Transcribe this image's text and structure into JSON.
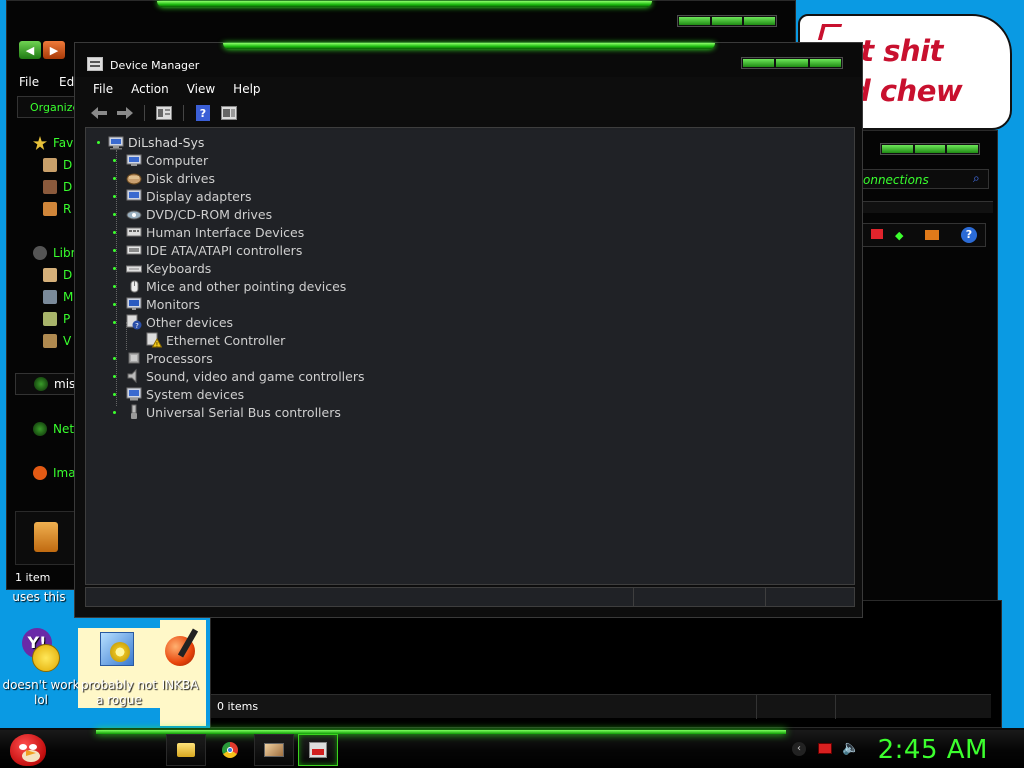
{
  "colors": {
    "desktop": "#0a9ae3",
    "accent_green": "#3cff2e",
    "window_bg": "#050505",
    "tree_bg": "#202226",
    "bubble_text": "#c8102e"
  },
  "explorer": {
    "menu": [
      "File",
      "Ed"
    ],
    "organize_label": "Organize",
    "sidebar": [
      {
        "label": "Fav",
        "icon": "star-icon"
      },
      {
        "label": "D",
        "icon": "folder-icon"
      },
      {
        "label": "D",
        "icon": "folder-icon"
      },
      {
        "label": "R",
        "icon": "folder-icon"
      },
      {
        "label": "Libr",
        "icon": "library-icon"
      },
      {
        "label": "D",
        "icon": "document-icon"
      },
      {
        "label": "M",
        "icon": "music-icon"
      },
      {
        "label": "P",
        "icon": "pictures-icon"
      },
      {
        "label": "V",
        "icon": "video-icon"
      }
    ],
    "homegroup_label": "mis",
    "network_label": "Net",
    "extra_label": "Ima",
    "status": "1 item"
  },
  "bubble": {
    "line1": "eat shit",
    "line2": "d chew"
  },
  "right_window": {
    "search_text": "onnections"
  },
  "bottom_window": {
    "status": "0 items"
  },
  "desktop_icons": [
    {
      "label": "uses this",
      "icon": "partial-icon"
    },
    {
      "label": "doesn't work lol",
      "icon": "yahoo-messenger-icon"
    },
    {
      "label": "probably not a rogue",
      "icon": "settings-gears-icon"
    },
    {
      "label": "INKBA",
      "icon": "inkball-icon"
    }
  ],
  "device_manager": {
    "title": "Device Manager",
    "menu": [
      "File",
      "Action",
      "View",
      "Help"
    ],
    "toolbar": [
      "back-arrow-icon",
      "forward-arrow-icon",
      "properties-icon",
      "help-icon",
      "view-icon"
    ],
    "root": "DiLshad-Sys",
    "nodes": [
      {
        "label": "Computer",
        "icon": "computer-icon"
      },
      {
        "label": "Disk drives",
        "icon": "disk-drive-icon"
      },
      {
        "label": "Display adapters",
        "icon": "display-adapter-icon"
      },
      {
        "label": "DVD/CD-ROM drives",
        "icon": "dvd-drive-icon"
      },
      {
        "label": "Human Interface Devices",
        "icon": "hid-icon"
      },
      {
        "label": "IDE ATA/ATAPI controllers",
        "icon": "ide-controller-icon"
      },
      {
        "label": "Keyboards",
        "icon": "keyboard-icon"
      },
      {
        "label": "Mice and other pointing devices",
        "icon": "mouse-icon"
      },
      {
        "label": "Monitors",
        "icon": "monitor-icon"
      },
      {
        "label": "Other devices",
        "icon": "unknown-device-icon"
      },
      {
        "label": "Ethernet Controller",
        "icon": "warning-device-icon",
        "child": true
      },
      {
        "label": "Processors",
        "icon": "processor-icon"
      },
      {
        "label": "Sound, video and game controllers",
        "icon": "speaker-icon"
      },
      {
        "label": "System devices",
        "icon": "system-device-icon"
      },
      {
        "label": "Universal Serial Bus controllers",
        "icon": "usb-icon"
      }
    ]
  },
  "taskbar": {
    "start": "angry-bird-start-icon",
    "pinned": [
      "explorer-icon",
      "chrome-icon",
      "media-icon",
      "device-manager-icon"
    ],
    "tray": [
      "back-icon",
      "display-icon",
      "volume-icon"
    ],
    "clock": "2:45 AM"
  }
}
